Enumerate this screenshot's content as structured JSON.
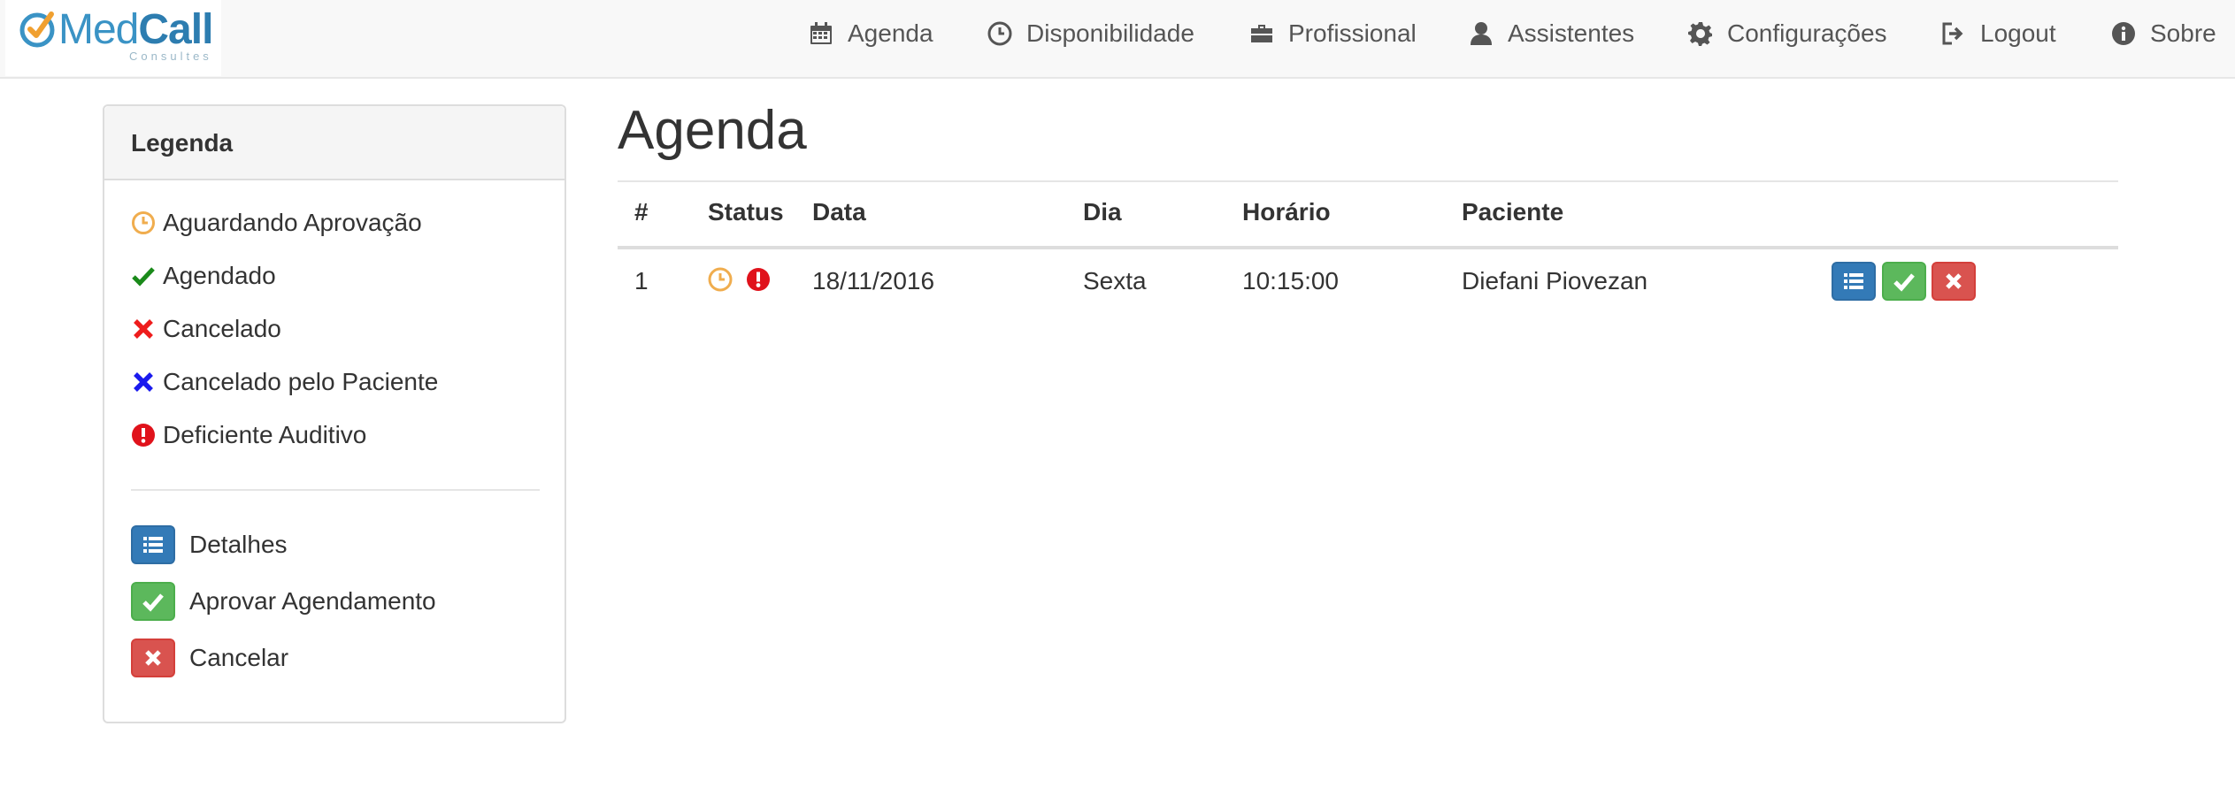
{
  "brand": {
    "name_part1": "Med",
    "name_part2": "Call",
    "tagline": "Consultes"
  },
  "nav": [
    {
      "label": "Agenda",
      "icon": "calendar-icon"
    },
    {
      "label": "Disponibilidade",
      "icon": "clock-icon"
    },
    {
      "label": "Profissional",
      "icon": "briefcase-icon"
    },
    {
      "label": "Assistentes",
      "icon": "user-icon"
    },
    {
      "label": "Configurações",
      "icon": "gear-icon"
    },
    {
      "label": "Logout",
      "icon": "logout-icon"
    },
    {
      "label": "Sobre",
      "icon": "info-icon"
    }
  ],
  "legend": {
    "title": "Legenda",
    "status_items": [
      {
        "label": "Aguardando Aprovação",
        "icon": "clock-icon",
        "color": "#f0ad4e"
      },
      {
        "label": "Agendado",
        "icon": "check-icon",
        "color": "#1a8a1a"
      },
      {
        "label": "Cancelado",
        "icon": "times-icon",
        "color": "#ee1c1c"
      },
      {
        "label": "Cancelado pelo Paciente",
        "icon": "times-icon",
        "color": "#1a1aee"
      },
      {
        "label": "Deficiente Auditivo",
        "icon": "exclamation-icon",
        "color": "#e0121b"
      }
    ],
    "action_items": [
      {
        "label": "Detalhes",
        "icon": "list-icon",
        "color": "#337ab7"
      },
      {
        "label": "Aprovar Agendamento",
        "icon": "check-icon",
        "color": "#5cb85c"
      },
      {
        "label": "Cancelar",
        "icon": "times-icon",
        "color": "#d9534f"
      }
    ]
  },
  "main": {
    "title": "Agenda",
    "table": {
      "columns": [
        "#",
        "Status",
        "Data",
        "Dia",
        "Horário",
        "Paciente"
      ],
      "rows": [
        {
          "num": "1",
          "data": "18/11/2016",
          "dia": "Sexta",
          "horario": "10:15:00",
          "paciente": "Diefani Piovezan",
          "status_icons": [
            "clock-icon",
            "exclamation-icon"
          ]
        }
      ]
    }
  },
  "colors": {
    "primary": "#337ab7",
    "success": "#5cb85c",
    "danger": "#d9534f",
    "warning": "#f0ad4e"
  }
}
